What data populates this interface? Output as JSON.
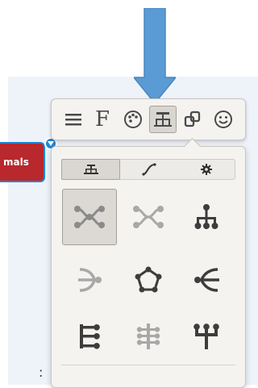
{
  "node": {
    "label": "mals"
  },
  "toolbar": {
    "items": [
      {
        "name": "menu",
        "icon": "hamburger-icon"
      },
      {
        "name": "font",
        "label": "F",
        "icon": "font-icon"
      },
      {
        "name": "palette",
        "icon": "palette-icon"
      },
      {
        "name": "structure",
        "icon": "org-chart-icon",
        "active": true
      },
      {
        "name": "attach",
        "icon": "link-box-icon"
      },
      {
        "name": "emoji",
        "icon": "smiley-icon"
      }
    ]
  },
  "panel": {
    "tabs": [
      {
        "name": "layout",
        "icon": "org-chart-icon",
        "active": true
      },
      {
        "name": "connector",
        "icon": "curve-icon"
      },
      {
        "name": "settings",
        "icon": "gear-icon"
      }
    ],
    "layouts": [
      {
        "name": "mind-map",
        "icon": "mindmap-icon",
        "selected": true
      },
      {
        "name": "mind-map-light",
        "icon": "mindmap-light-icon"
      },
      {
        "name": "org-chart",
        "icon": "org-chart-down-icon"
      },
      {
        "name": "right-fan",
        "icon": "right-fan-icon"
      },
      {
        "name": "cycle",
        "icon": "pentagon-icon"
      },
      {
        "name": "left-fan",
        "icon": "left-fan-icon"
      },
      {
        "name": "tree-left",
        "icon": "tree-left-icon"
      },
      {
        "name": "fishbone",
        "icon": "fishbone-icon"
      },
      {
        "name": "trident",
        "icon": "trident-icon"
      }
    ]
  },
  "colors": {
    "arrow": "#5b9bd5",
    "node": "#b8282c",
    "selection": "#1f86d6",
    "icon_dark": "#3d3d3d",
    "icon_light": "#9a9a9a"
  },
  "stray_text": ":"
}
